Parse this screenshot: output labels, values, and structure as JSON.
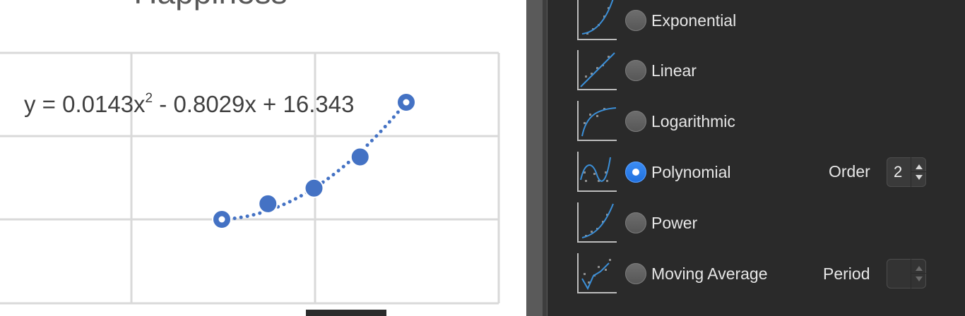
{
  "chart": {
    "title": "Happiness",
    "equation_prefix": "y = 0.0143x",
    "equation_exponent": "2",
    "equation_suffix": " - 0.8029x + 16.343"
  },
  "chart_data": {
    "type": "scatter",
    "title": "Happiness",
    "series": [
      {
        "name": "",
        "x": [
          1,
          2,
          3,
          4,
          5
        ],
        "y": [
          1.0,
          1.2,
          1.4,
          1.8,
          2.5
        ]
      }
    ],
    "trendline": {
      "type": "polynomial",
      "order": 2,
      "style": "dotted",
      "equation": "y = 0.0143x2 - 0.8029x + 16.343"
    },
    "grid": true,
    "colors": {
      "series": "#4472c4",
      "gridline": "#d9d9d9"
    }
  },
  "format_pane": {
    "trendline_options": [
      {
        "label": "Exponential",
        "icon": "exponential-trend-icon",
        "selected": false
      },
      {
        "label": "Linear",
        "icon": "linear-trend-icon",
        "selected": false
      },
      {
        "label": "Logarithmic",
        "icon": "logarithmic-trend-icon",
        "selected": false
      },
      {
        "label": "Polynomial",
        "icon": "polynomial-trend-icon",
        "selected": true
      },
      {
        "label": "Power",
        "icon": "power-trend-icon",
        "selected": false
      },
      {
        "label": "Moving Average",
        "icon": "moving-average-trend-icon",
        "selected": false
      }
    ],
    "order_label": "Order",
    "order_value": "2",
    "period_label": "Period",
    "period_value": ""
  },
  "colors": {
    "accent": "#2a7ae8",
    "pane_background": "#2a2a2a",
    "trend_icon_line": "#3b8fd8"
  }
}
